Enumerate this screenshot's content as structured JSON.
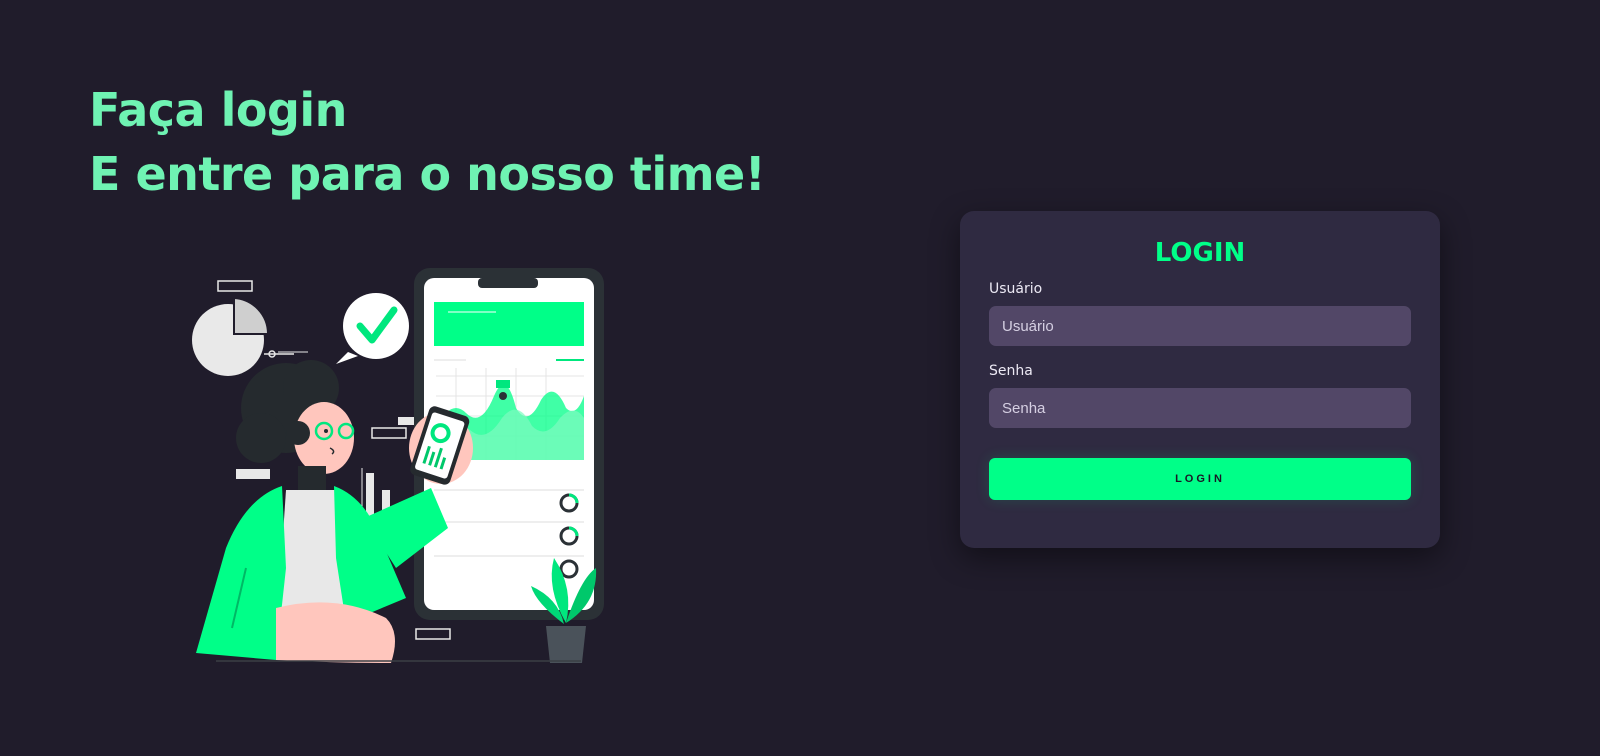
{
  "hero": {
    "line1": "Faça login",
    "line2": "E entre para o nosso time!"
  },
  "illustration": {
    "icon": "person-with-phone-analytics-illustration"
  },
  "login_card": {
    "title": "LOGIN",
    "username": {
      "label": "Usuário",
      "placeholder": "Usuário",
      "value": ""
    },
    "password": {
      "label": "Senha",
      "placeholder": "Senha",
      "value": ""
    },
    "submit_label": "LOGIN"
  },
  "colors": {
    "background": "#201c2b",
    "accent": "#00ff88",
    "headline": "#6ff3b3",
    "card": "#2f2a41",
    "input": "#524767"
  }
}
